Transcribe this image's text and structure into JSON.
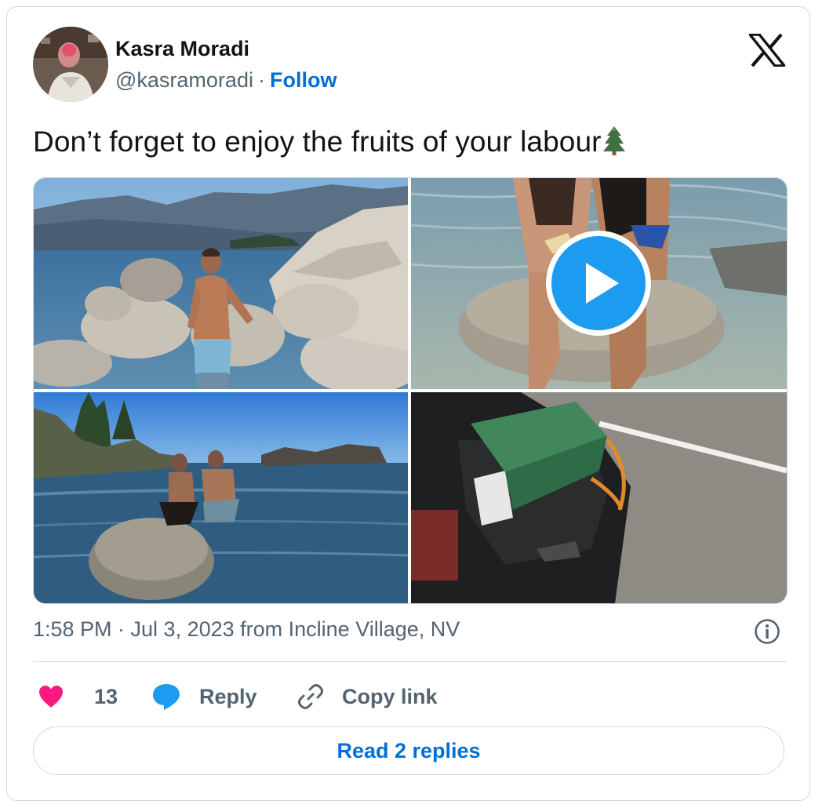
{
  "author": {
    "name": "Kasra Moradi",
    "handle": "@kasramoradi",
    "separator": "·",
    "follow_label": "Follow"
  },
  "tweet": {
    "text": "Don’t forget to enjoy the fruits of your labour",
    "emoji": "evergreen-tree-icon"
  },
  "media": {
    "items": [
      {
        "kind": "photo",
        "icon": "photo-man-on-rocks"
      },
      {
        "kind": "video",
        "icon": "play-icon"
      },
      {
        "kind": "photo",
        "icon": "photo-two-men-on-rock"
      },
      {
        "kind": "photo",
        "icon": "photo-car-trunk-bag"
      }
    ]
  },
  "meta": {
    "timestamp": "1:58 PM · Jul 3, 2023 from Incline Village, NV"
  },
  "actions": {
    "like_count": "13",
    "reply_label": "Reply",
    "copy_label": "Copy link"
  },
  "footer": {
    "read_replies_label": "Read 2 replies"
  },
  "colors": {
    "link": "#006fd6",
    "like": "#f91880",
    "reply": "#1d9bf0",
    "muted": "#536471",
    "border": "#cfd9de"
  }
}
